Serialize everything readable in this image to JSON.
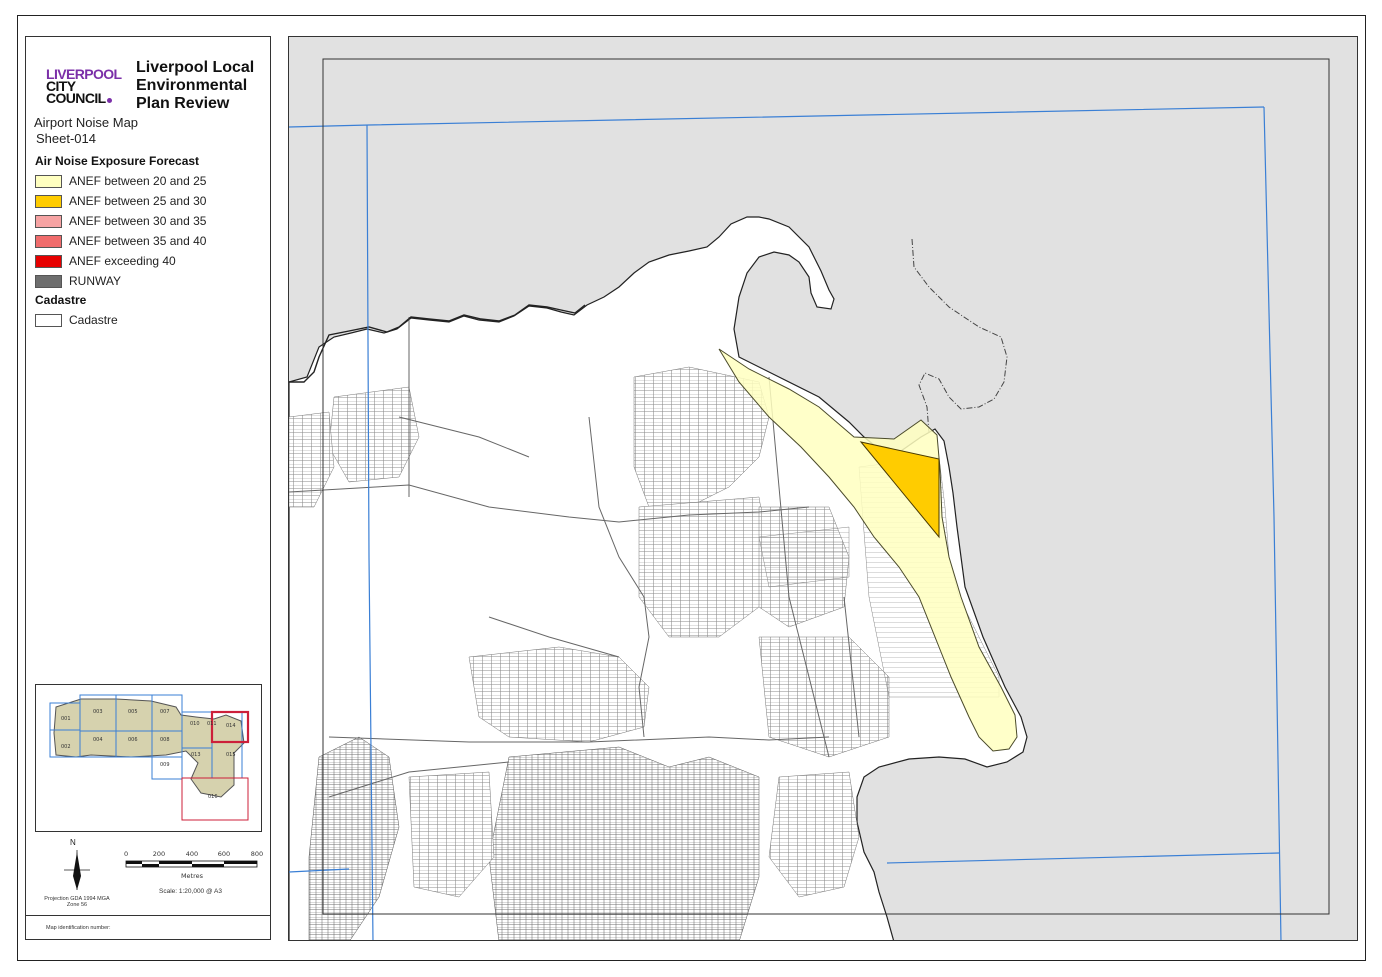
{
  "logo": {
    "line1": "LIVERPOOL",
    "line2": "CITY",
    "line3": "COUNCIL",
    "accent_color": "#7b2fa8"
  },
  "title": "Liverpool Local\nEnvironmental\nPlan Review",
  "subtitle": "Airport Noise Map",
  "sheet": "Sheet-014",
  "legend": {
    "sections": [
      {
        "heading": "Air Noise Exposure Forecast",
        "items": [
          {
            "label": "ANEF between 20 and 25",
            "color": "#ffffc0"
          },
          {
            "label": "ANEF between 25 and 30",
            "color": "#ffcc00"
          },
          {
            "label": "ANEF between 30 and 35",
            "color": "#f6a3a3"
          },
          {
            "label": "ANEF between 35 and 40",
            "color": "#f06c6c"
          },
          {
            "label": "ANEF exceeding 40",
            "color": "#e60000"
          },
          {
            "label": "RUNWAY",
            "color": "#6e6e6e"
          }
        ]
      },
      {
        "heading": "Cadastre",
        "items": [
          {
            "label": "Cadastre",
            "color": "#ffffff"
          }
        ]
      }
    ]
  },
  "inset_map": {
    "sheets": [
      "001",
      "002",
      "003",
      "004",
      "005",
      "006",
      "007",
      "008",
      "009",
      "010",
      "011",
      "013",
      "014",
      "015",
      "016"
    ],
    "current_sheet": "014",
    "grid_color": "#3a7fd5",
    "highlight_color": "#cc1f3a"
  },
  "north_arrow_label": "N",
  "scale": {
    "ticks": [
      "0",
      "200",
      "400",
      "600",
      "800"
    ],
    "unit": "Metres",
    "text": "Scale: 1:20,000 @ A3"
  },
  "projection": "Projection GDA 1994 MGA Zone 56",
  "map_id_label": "Map identification number:",
  "map_colors": {
    "background": "#e1e1e1",
    "land": "#ffffff",
    "sheet_grid": "#3a7fd5",
    "anef_20_25": "#ffffc0",
    "anef_25_30": "#ffcc00"
  }
}
